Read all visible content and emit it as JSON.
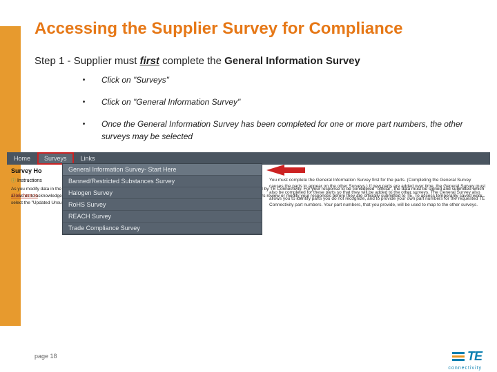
{
  "title": "Accessing the Supplier Survey for Compliance",
  "step_prefix": "Step 1 - Supplier must ",
  "step_first": "first",
  "step_mid": " complete the ",
  "step_bold": "General Information Survey",
  "bullets": [
    "Click on \"Surveys\"",
    "Click on \"General Information Survey\"",
    "Once the General Information Survey has been completed for one or more part numbers, the other surveys may be selected"
  ],
  "screenshot": {
    "tabs": [
      "Home",
      "Surveys",
      "Links"
    ],
    "survey_label": "Survey Ho",
    "dropdown": [
      "General Information Survey- Start Here",
      "Banned/Restricted Substances Survey",
      "Halogen Survey",
      "RoHS Survey",
      "REACH Survey",
      "Trade Compliance Survey"
    ],
    "instr_icon_text": "Instructions",
    "click_here": "Click here to",
    "para0": "You must complete the General Information Survey first for the parts. (Completing the General Survey causes the parts to appear on the other Surveys.) If new parts are added over time, the General Survey must also be completed for these parts so that they will be added to the other surveys. The General Survey also allows you to identify parts you do not recognize, and to provide your own part numbers for the requested TE Connectivity part numbers. Your part numbers, that you provide, will be used to map to the other surveys.",
    "para1": "As you modify data in the various surveys, the data is saved in a temporary workspace. Temporarily saved data is not reviewed by TE Connectivity. For your response to be considered \"official\", the data must be signed and submitted which allows us to acknowledge its receipt. Temporarily saved data is available to other users at your company. This feature lets others review or modify your responses before they are officially submitted to TE. To access temporarily saved work, select the \"Updated Unsubmitted Parts\" menu option within the survey you are interested in viewing."
  },
  "page_label": "page 18",
  "logo": {
    "text": "TE",
    "sub": "connectivity"
  }
}
